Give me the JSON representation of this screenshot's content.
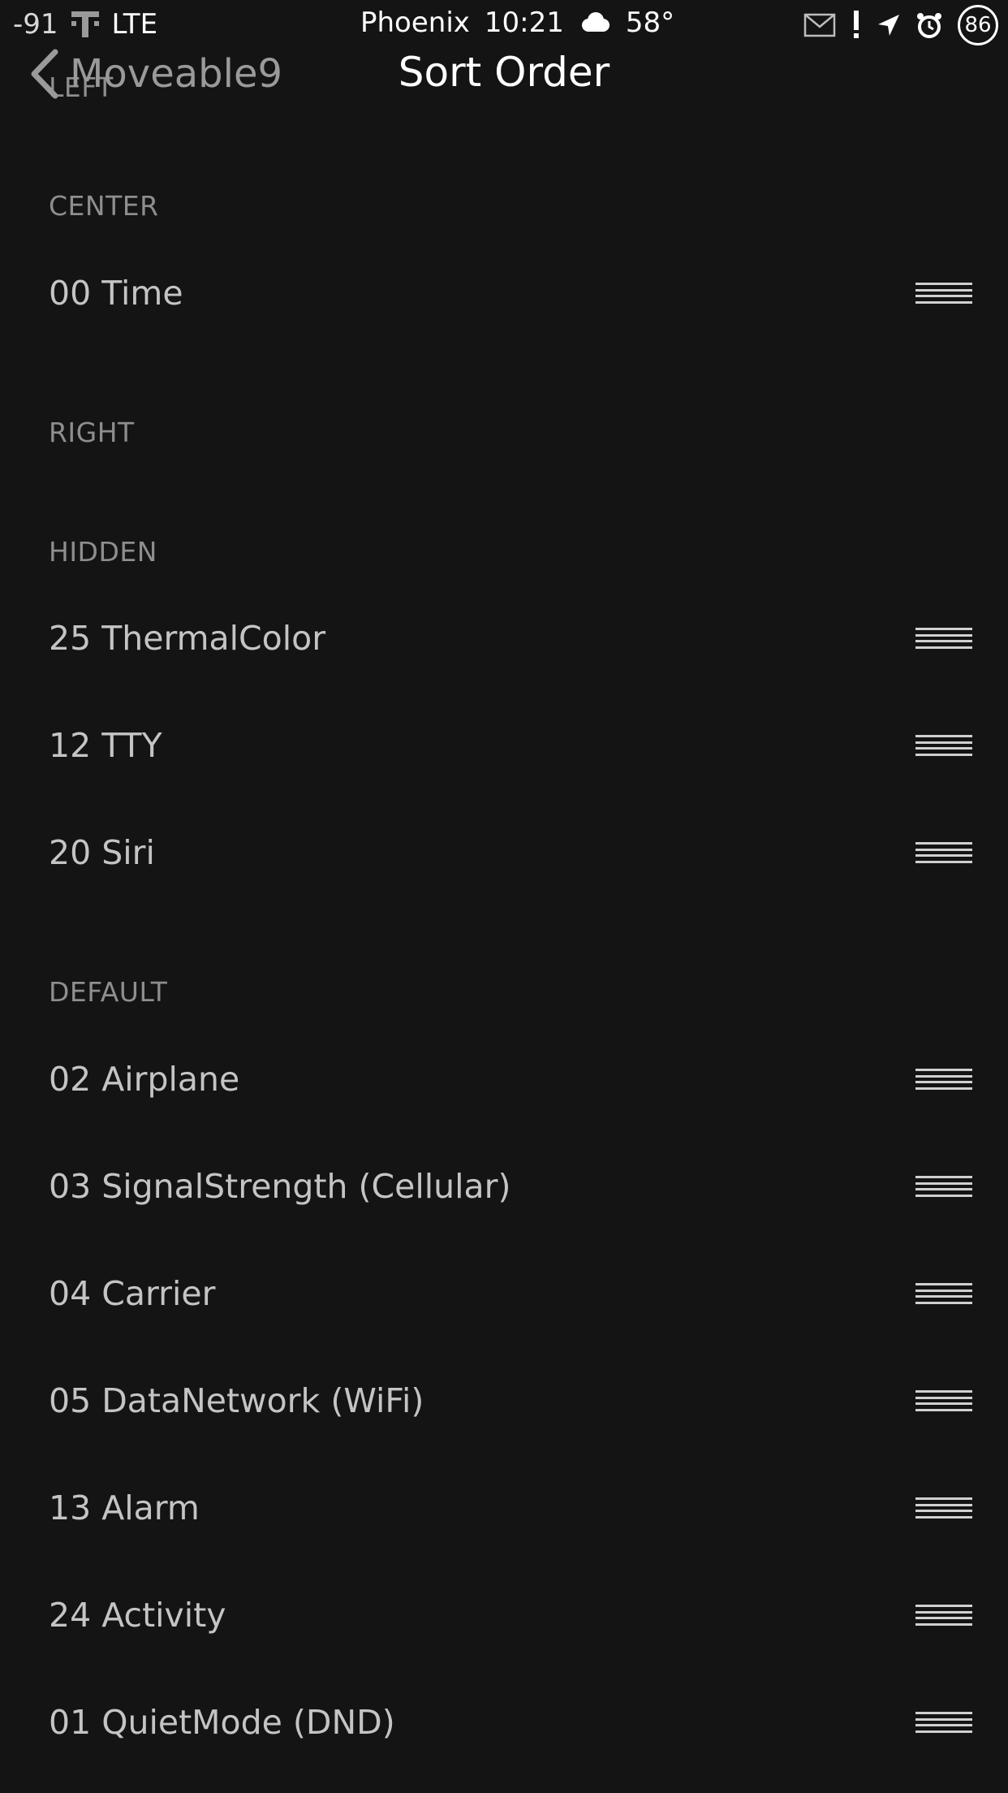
{
  "status_bar": {
    "signal": "-91",
    "network": "LTE",
    "city": "Phoenix",
    "time": "10:21",
    "temperature": "58°",
    "battery": "86"
  },
  "nav": {
    "back_label": "Moveable9",
    "title": "Sort Order"
  },
  "sections": {
    "left": {
      "header": "LEFT"
    },
    "center": {
      "header": "CENTER",
      "items": [
        "00 Time"
      ]
    },
    "right": {
      "header": "RIGHT"
    },
    "hidden": {
      "header": "HIDDEN",
      "items": [
        "25 ThermalColor",
        "12 TTY",
        "20 Siri"
      ]
    },
    "default": {
      "header": "DEFAULT",
      "items": [
        "02 Airplane",
        "03 SignalStrength (Cellular)",
        "04 Carrier",
        "05 DataNetwork (WiFi)",
        "13 Alarm",
        "24 Activity",
        "01 QuietMode (DND)"
      ]
    }
  },
  "colors": {
    "background": "#141414",
    "text": "#c4c4c4",
    "header": "#8e8e8e"
  }
}
